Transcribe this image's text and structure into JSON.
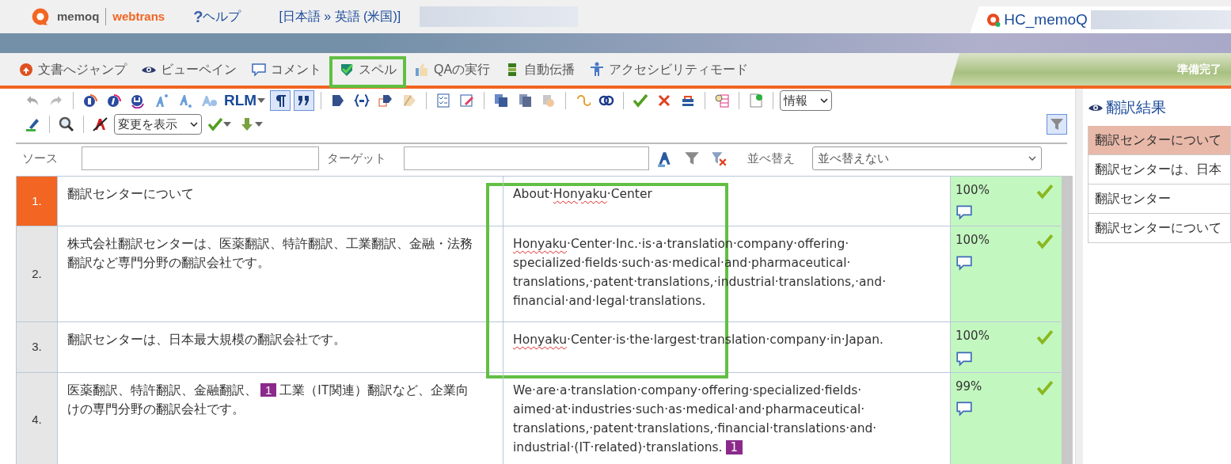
{
  "header": {
    "logo_name": "memoq",
    "logo_product": "webtrans",
    "help_icon": "?",
    "help": "ヘルプ",
    "language_pair": "[日本語 » 英語 (米国)]",
    "document_tab": "HC_memoQ"
  },
  "menu": [
    {
      "label": "文書へジャンプ",
      "highlighted": false
    },
    {
      "label": "ビューペイン",
      "highlighted": false
    },
    {
      "label": "コメント",
      "highlighted": false
    },
    {
      "label": "スペル",
      "highlighted": true
    },
    {
      "label": "QAの実行",
      "highlighted": false
    },
    {
      "label": "自動伝播",
      "highlighted": false
    },
    {
      "label": "アクセシビリティモード",
      "highlighted": false
    }
  ],
  "status": "準備完了",
  "toolbar": {
    "row_1": [
      {
        "kind": "icon"
      },
      {
        "kind": "icon"
      },
      {
        "kind": "sep"
      },
      {
        "kind": "icon"
      },
      {
        "kind": "icon"
      },
      {
        "kind": "icon"
      },
      {
        "kind": "icon"
      },
      {
        "kind": "icon"
      },
      {
        "kind": "icon"
      },
      {
        "kind": "text-menu",
        "label": "RLM"
      },
      {
        "kind": "toggle",
        "selected": true
      },
      {
        "kind": "toggle",
        "selected": true
      },
      {
        "kind": "sep"
      },
      {
        "kind": "icon"
      },
      {
        "kind": "icon"
      },
      {
        "kind": "icon"
      },
      {
        "kind": "icon"
      },
      {
        "kind": "sep"
      },
      {
        "kind": "icon"
      },
      {
        "kind": "icon"
      },
      {
        "kind": "sep"
      },
      {
        "kind": "icon"
      },
      {
        "kind": "icon"
      },
      {
        "kind": "icon"
      },
      {
        "kind": "sep"
      },
      {
        "kind": "icon"
      },
      {
        "kind": "icon"
      },
      {
        "kind": "sep"
      },
      {
        "kind": "icon"
      },
      {
        "kind": "icon"
      },
      {
        "kind": "icon"
      },
      {
        "kind": "sep"
      },
      {
        "kind": "icon"
      },
      {
        "kind": "sep"
      },
      {
        "kind": "icon"
      },
      {
        "kind": "sep"
      },
      {
        "kind": "select",
        "value": "情報"
      }
    ],
    "row_2": [
      {
        "kind": "icon"
      },
      {
        "kind": "sep"
      },
      {
        "kind": "icon"
      },
      {
        "kind": "sep"
      },
      {
        "kind": "icon"
      },
      {
        "kind": "select",
        "value": "変更を表示"
      },
      {
        "kind": "icon-menu"
      },
      {
        "kind": "icon-menu"
      }
    ],
    "filter_toggle": {
      "selected": true
    }
  },
  "filter": {
    "source_label": "ソース",
    "target_label": "ターゲット",
    "sort_label": "並べ替え",
    "sort_value": "並べ替えない"
  },
  "rows": [
    {
      "number": "1.",
      "selected": true,
      "highlighted": true,
      "source": [
        {
          "kind": "text",
          "text": "翻訳センターについて"
        }
      ],
      "target": [
        {
          "kind": "text",
          "text": "About·"
        },
        {
          "kind": "misspelled",
          "text": "Honyaku"
        },
        {
          "kind": "text",
          "text": "·Center"
        }
      ],
      "match": "100%",
      "confirmed": true
    },
    {
      "number": "2.",
      "selected": false,
      "highlighted": true,
      "source": [
        {
          "kind": "text",
          "text": "株式会社翻訳センターは、医薬翻訳、特許翻訳、工業翻訳、金融・法務翻訳など専門分野の翻訳会社です。"
        }
      ],
      "target": [
        {
          "kind": "misspelled",
          "text": "Honyaku"
        },
        {
          "kind": "text",
          "text": "·Center·Inc.·is·a·translation·company·offering·specialized·fields·such·as·medical·and·pharmaceutical·translations,·patent·translations,·industrial·translations,·and·financial·and·legal·translations."
        }
      ],
      "match": "100%",
      "confirmed": true
    },
    {
      "number": "3.",
      "selected": false,
      "highlighted": true,
      "source": [
        {
          "kind": "text",
          "text": "翻訳センターは、日本最大規模の翻訳会社です。"
        }
      ],
      "target": [
        {
          "kind": "misspelled",
          "text": "Honyaku"
        },
        {
          "kind": "text",
          "text": "·Center·is·the·largest·translation·company·in·Japan."
        }
      ],
      "match": "100%",
      "confirmed": true
    },
    {
      "number": "4.",
      "selected": false,
      "highlighted": false,
      "source": [
        {
          "kind": "text",
          "text": "医薬翻訳、特許翻訳、金融翻訳、"
        },
        {
          "kind": "tag",
          "text": "1"
        },
        {
          "kind": "text",
          "text": "工業（IT関連）翻訳など、企業向けの専門分野の翻訳会社です。"
        }
      ],
      "target": [
        {
          "kind": "text",
          "text": "We·are·a·translation·company·offering·specialized·fields·aimed·at·industries·such·as·medical·and·pharmaceutical·translations,·patent·translations,·financial·translations·and·industrial·(IT·related)·translations."
        },
        {
          "kind": "tag",
          "text": "1"
        }
      ],
      "match": "99%",
      "confirmed": true
    }
  ],
  "results": {
    "title": "翻訳結果",
    "items": [
      {
        "text": "翻訳センターについて",
        "selected": true
      },
      {
        "text": "翻訳センターは、日本",
        "selected": false
      },
      {
        "text": "翻訳センター",
        "selected": false
      },
      {
        "text": "翻訳センターについて",
        "selected": false
      }
    ]
  }
}
